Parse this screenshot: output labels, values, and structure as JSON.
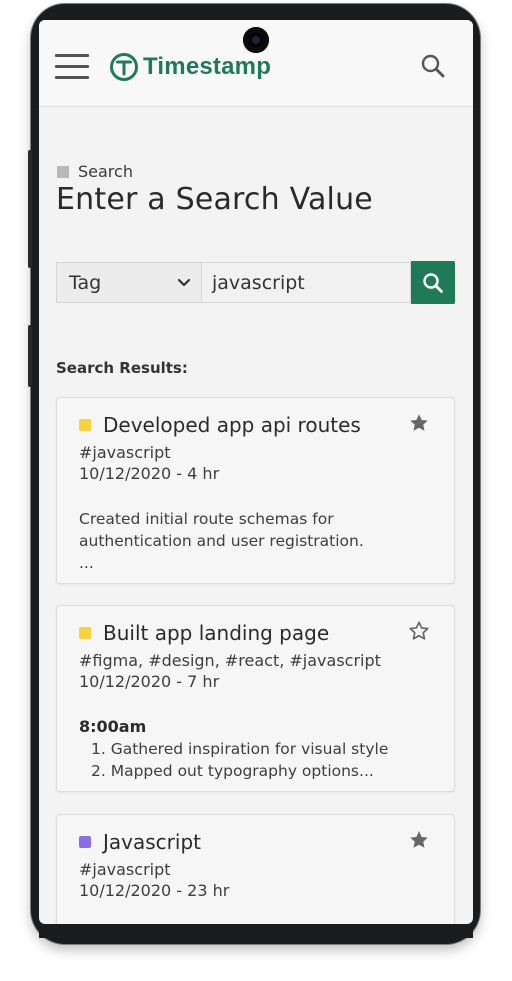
{
  "app": {
    "brand": "Timestamp",
    "brand_color": "#1f7a5a"
  },
  "header": {
    "menu_icon": "hamburger-menu-icon",
    "search_icon": "search-icon"
  },
  "page": {
    "breadcrumb": "Search",
    "title": "Enter a Search Value"
  },
  "search": {
    "filter_selected": "Tag",
    "query": "javascript",
    "button_icon": "search-icon"
  },
  "results": {
    "label": "Search Results:",
    "items": [
      {
        "title": "Developed app api routes",
        "color": "#f4d43c",
        "tags": "#javascript",
        "date": "10/12/2020 - 4 hr",
        "starred": true,
        "body_line1": "Created initial route schemas for",
        "body_line2": "authentication and user registration.",
        "body_line3": "..."
      },
      {
        "title": "Built app landing page",
        "color": "#f4d43c",
        "tags": "#figma, #design, #react, #javascript",
        "date": "10/12/2020 - 7 hr",
        "starred": false,
        "time": "8:00am",
        "list1": "1. Gathered inspiration for visual style",
        "list2": "2. Mapped out typography options..."
      },
      {
        "title": "Javascript",
        "color": "#8b6fe0",
        "tags": "#javascript",
        "date": "10/12/2020 - 23 hr",
        "starred": true
      }
    ]
  }
}
